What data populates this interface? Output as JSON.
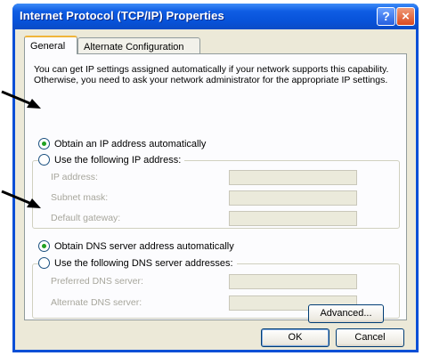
{
  "window": {
    "title": "Internet Protocol (TCP/IP) Properties",
    "help_label": "?",
    "close_label": "×"
  },
  "tabs": [
    {
      "label": "General",
      "active": true
    },
    {
      "label": "Alternate Configuration",
      "active": false
    }
  ],
  "description": "You can get IP settings assigned automatically if your network supports this capability. Otherwise, you need to ask your network administrator for the appropriate IP settings.",
  "ip": {
    "auto_label": "Obtain an IP address automatically",
    "auto_selected": true,
    "manual_label": "Use the following IP address:",
    "fields": [
      {
        "label": "IP address:",
        "value": ""
      },
      {
        "label": "Subnet mask:",
        "value": ""
      },
      {
        "label": "Default gateway:",
        "value": ""
      }
    ]
  },
  "dns": {
    "auto_label": "Obtain DNS server address automatically",
    "auto_selected": true,
    "manual_label": "Use the following DNS server addresses:",
    "fields": [
      {
        "label": "Preferred DNS server:",
        "value": ""
      },
      {
        "label": "Alternate DNS server:",
        "value": ""
      }
    ]
  },
  "buttons": {
    "advanced": "Advanced...",
    "ok": "OK",
    "cancel": "Cancel"
  },
  "colors": {
    "titlebar": "#0a4fd6",
    "dialog_face": "#ece9d8",
    "selected_radio": "#21a121",
    "active_tab_accent": "#f0b53a"
  }
}
